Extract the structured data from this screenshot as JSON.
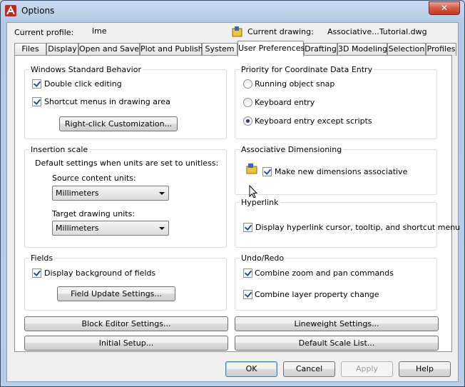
{
  "window": {
    "title": "Options",
    "close_label": "✕"
  },
  "profile": {
    "label": "Current profile:",
    "value": "lme"
  },
  "drawing": {
    "label": "Current drawing:",
    "value": "Associative...Tutorial.dwg"
  },
  "tabs": [
    "Files",
    "Display",
    "Open and Save",
    "Plot and Publish",
    "System",
    "User Preferences",
    "Drafting",
    "3D Modeling",
    "Selection",
    "Profiles"
  ],
  "active_tab": "User Preferences",
  "windows_behavior": {
    "title": "Windows Standard Behavior",
    "double_click": "Double click editing",
    "shortcut_menus": "Shortcut menus in drawing area",
    "right_click_button": "Right-click Customization..."
  },
  "insertion_scale": {
    "title": "Insertion scale",
    "desc": "Default settings when units are set to unitless:",
    "source_label": "Source content units:",
    "source_value": "Millimeters",
    "target_label": "Target drawing units:",
    "target_value": "Millimeters"
  },
  "fields": {
    "title": "Fields",
    "display_background": "Display background of fields",
    "update_button": "Field Update Settings..."
  },
  "priority": {
    "title": "Priority for Coordinate Data Entry",
    "options": [
      "Running object snap",
      "Keyboard entry",
      "Keyboard entry except scripts"
    ],
    "selected": "Keyboard entry except scripts"
  },
  "assoc_dim": {
    "title": "Associative Dimensioning",
    "make_assoc": "Make new dimensions associative"
  },
  "hyperlink": {
    "title": "Hyperlink",
    "display": "Display hyperlink cursor, tooltip, and shortcut menu"
  },
  "undo_redo": {
    "title": "Undo/Redo",
    "combine_zoom": "Combine zoom and pan commands",
    "combine_layer": "Combine layer property change"
  },
  "buttons": {
    "block_editor": "Block Editor Settings...",
    "lineweight": "Lineweight Settings...",
    "initial_setup": "Initial Setup...",
    "default_scale": "Default Scale List...",
    "ok": "OK",
    "cancel": "Cancel",
    "apply": "Apply",
    "help": "Help"
  }
}
